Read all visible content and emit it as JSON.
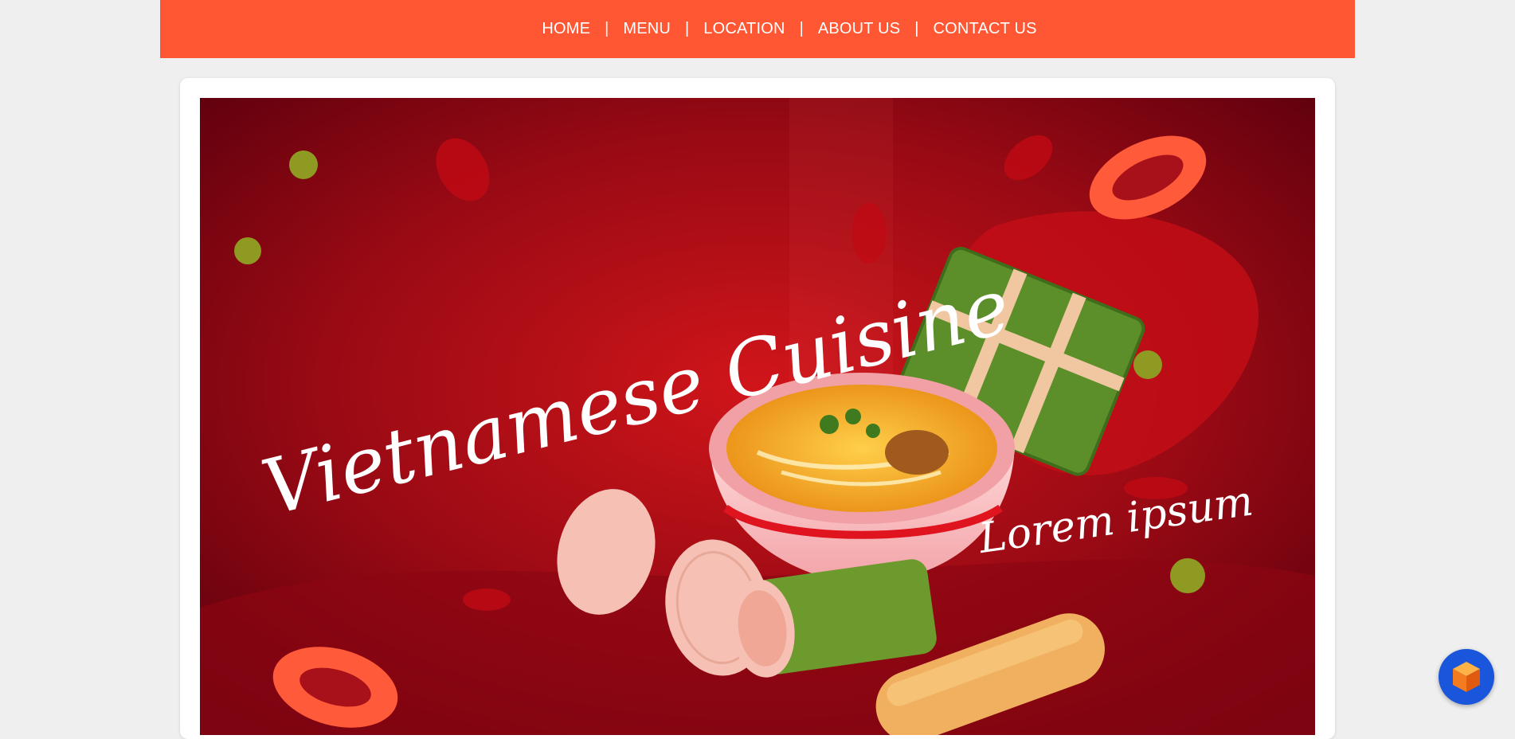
{
  "nav": {
    "items": [
      {
        "label": "HOME"
      },
      {
        "label": "MENU"
      },
      {
        "label": "LOCATION"
      },
      {
        "label": "ABOUT US"
      },
      {
        "label": "CONTACT US"
      }
    ],
    "separator": "|"
  },
  "hero": {
    "headline": "Vietnamese Cuisine",
    "tagline": "Lorem ipsum"
  },
  "fab": {
    "icon": "cube-icon"
  },
  "colors": {
    "nav_background": "#ff5733",
    "page_background": "#efefef",
    "hero_background": "#7a0010",
    "fab_background": "#1a56db"
  }
}
